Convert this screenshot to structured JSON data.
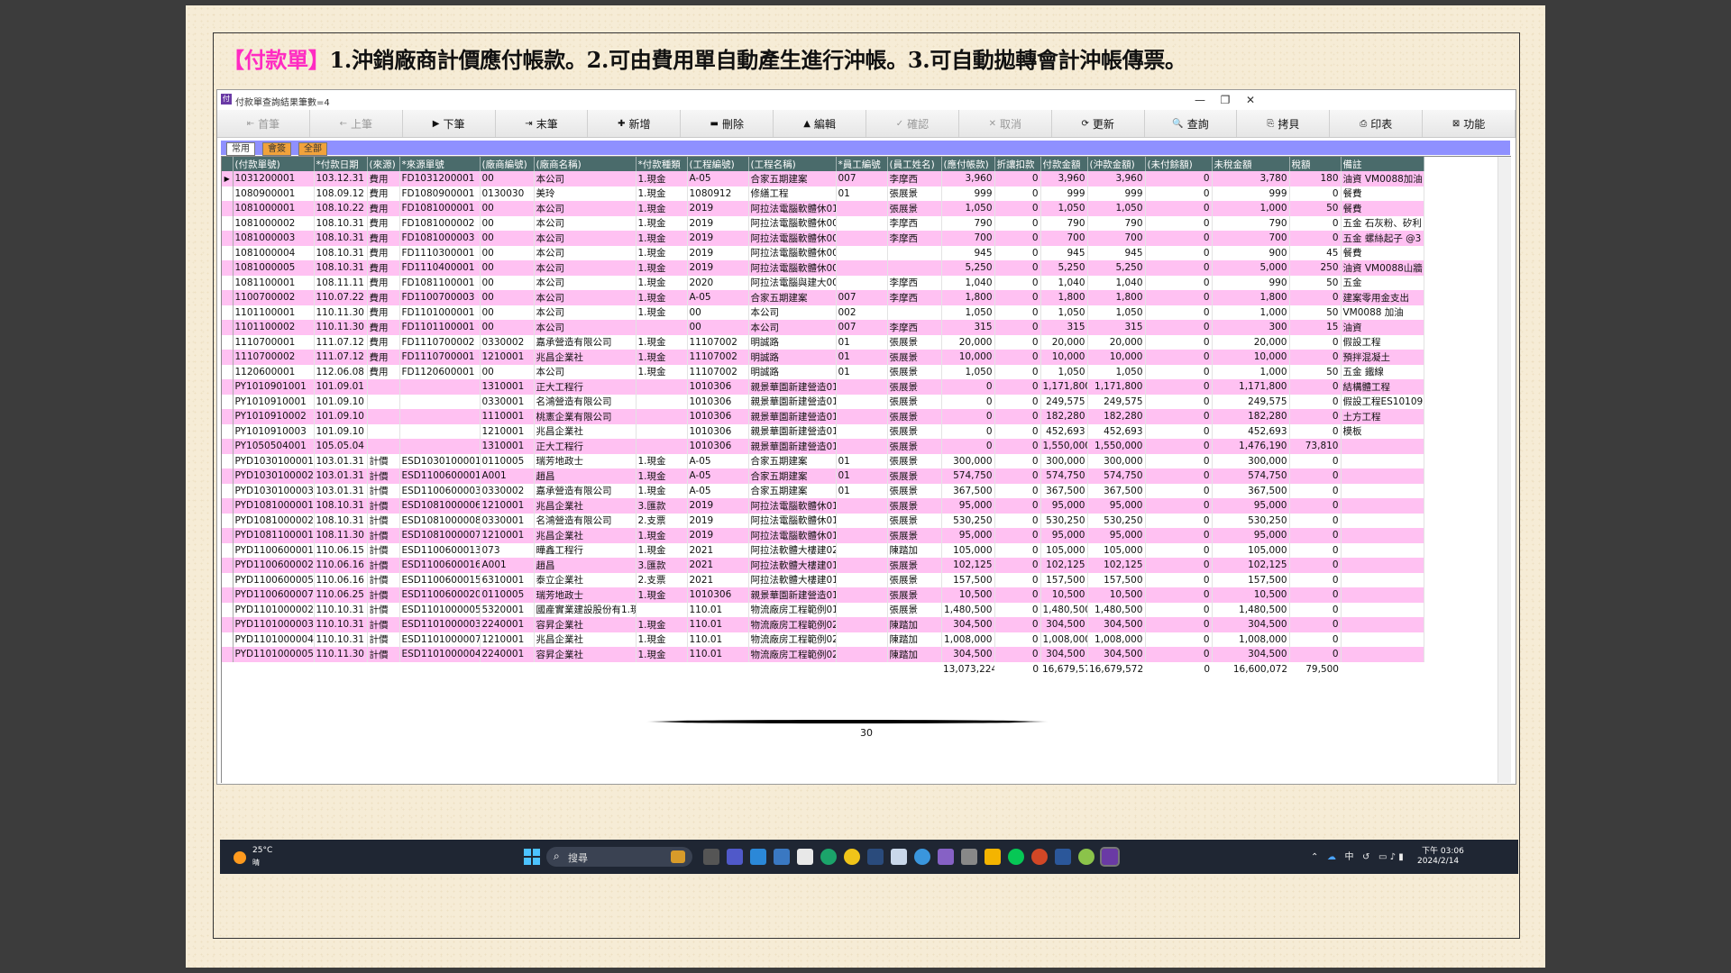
{
  "heading": {
    "tag": "【付款單】",
    "text": "1.沖銷廠商計價應付帳款。2.可由費用單自動產生進行沖帳。3.可自動拋轉會計沖帳傳票。"
  },
  "window": {
    "title": "付款單查詢結果筆數=4",
    "minimize": "—",
    "maximize": "❐",
    "close": "✕"
  },
  "toolbar": [
    {
      "icon": "⇤",
      "label": "首筆",
      "disabled": true
    },
    {
      "icon": "←",
      "label": "上筆",
      "disabled": true
    },
    {
      "icon": "▶",
      "label": "下筆",
      "disabled": false
    },
    {
      "icon": "⇥",
      "label": "末筆",
      "disabled": false
    },
    {
      "icon": "✚",
      "label": "新增",
      "disabled": false
    },
    {
      "icon": "▬",
      "label": "刪除",
      "disabled": false
    },
    {
      "icon": "▲",
      "label": "編輯",
      "disabled": false
    },
    {
      "icon": "✓",
      "label": "確認",
      "disabled": true
    },
    {
      "icon": "✕",
      "label": "取消",
      "disabled": true
    },
    {
      "icon": "⟳",
      "label": "更新",
      "disabled": false
    },
    {
      "icon": "🔍",
      "label": "查詢",
      "disabled": false
    },
    {
      "icon": "⎘",
      "label": "拷貝",
      "disabled": false
    },
    {
      "icon": "⎙",
      "label": "印表",
      "disabled": false
    },
    {
      "icon": "⊠",
      "label": "功能",
      "disabled": false
    }
  ],
  "tabs": [
    "常用",
    "會簽",
    "全部"
  ],
  "table": {
    "columns": [
      "(付款單號)",
      "*付款日期",
      "(來源)",
      "*來源單號",
      "(廠商編號)",
      "(廠商名稱)",
      "*付款種類",
      "(工程編號)",
      "(工程名稱)",
      "*員工編號",
      "(員工姓名)",
      "(應付帳款)",
      "折讓扣款",
      "付款金額",
      "(沖款金額)",
      "(未付餘額)",
      "未稅金額",
      "稅額",
      "備註"
    ],
    "rows": [
      [
        "1031200001",
        "103.12.31",
        "費用",
        "FD1031200001",
        "00",
        "本公司",
        "1.現金",
        "A-05",
        "合家五期建案",
        "007",
        "李摩西",
        "3,960",
        "0",
        "3,960",
        "3,960",
        "0",
        "3,780",
        "180",
        "油資 VM0088加油"
      ],
      [
        "1080900001",
        "108.09.12",
        "費用",
        "FD1080900001",
        "0130030",
        "美玲",
        "1.現金",
        "1080912",
        "修繕工程",
        "01",
        "張展景",
        "999",
        "0",
        "999",
        "999",
        "0",
        "999",
        "0",
        "餐費"
      ],
      [
        "1081000001",
        "108.10.22",
        "費用",
        "FD1081000001",
        "00",
        "本公司",
        "1.現金",
        "2019",
        "阿拉法電腦軟體休01",
        "",
        "張展景",
        "1,050",
        "0",
        "1,050",
        "1,050",
        "0",
        "1,000",
        "50",
        "餐費"
      ],
      [
        "1081000002",
        "108.10.31",
        "費用",
        "FD1081000002",
        "00",
        "本公司",
        "1.現金",
        "2019",
        "阿拉法電腦軟體休007",
        "",
        "李摩西",
        "790",
        "0",
        "790",
        "790",
        "0",
        "790",
        "0",
        "五金 石灰粉、矽利"
      ],
      [
        "1081000003",
        "108.10.31",
        "費用",
        "FD1081000003",
        "00",
        "本公司",
        "1.現金",
        "2019",
        "阿拉法電腦軟體休007",
        "",
        "李摩西",
        "700",
        "0",
        "700",
        "700",
        "0",
        "700",
        "0",
        "五金 螺絲起子 @3"
      ],
      [
        "1081000004",
        "108.10.31",
        "費用",
        "FD1110300001",
        "00",
        "本公司",
        "1.現金",
        "2019",
        "阿拉法電腦軟體休002",
        "",
        "",
        "945",
        "0",
        "945",
        "945",
        "0",
        "900",
        "45",
        "餐費"
      ],
      [
        "1081000005",
        "108.10.31",
        "費用",
        "FD1110400001",
        "00",
        "本公司",
        "1.現金",
        "2019",
        "阿拉法電腦軟體休002",
        "",
        "",
        "5,250",
        "0",
        "5,250",
        "5,250",
        "0",
        "5,000",
        "250",
        "油資 VM0088山牆"
      ],
      [
        "1081100001",
        "108.11.11",
        "費用",
        "FD1081100001",
        "00",
        "本公司",
        "1.現金",
        "2020",
        "阿拉法電腦與建大007",
        "",
        "李摩西",
        "1,040",
        "0",
        "1,040",
        "1,040",
        "0",
        "990",
        "50",
        "五金"
      ],
      [
        "1100700002",
        "110.07.22",
        "費用",
        "FD1100700003",
        "00",
        "本公司",
        "1.現金",
        "A-05",
        "合家五期建案",
        "007",
        "李摩西",
        "1,800",
        "0",
        "1,800",
        "1,800",
        "0",
        "1,800",
        "0",
        "建案零用金支出"
      ],
      [
        "1101100001",
        "110.11.30",
        "費用",
        "FD1101000001",
        "00",
        "本公司",
        "1.現金",
        "00",
        "本公司",
        "002",
        "",
        "1,050",
        "0",
        "1,050",
        "1,050",
        "0",
        "1,000",
        "50",
        "VM0088 加油"
      ],
      [
        "1101100002",
        "110.11.30",
        "費用",
        "FD1101100001",
        "00",
        "本公司",
        "",
        "00",
        "本公司",
        "007",
        "李摩西",
        "315",
        "0",
        "315",
        "315",
        "0",
        "300",
        "15",
        "油資"
      ],
      [
        "1110700001",
        "111.07.12",
        "費用",
        "FD1110700002",
        "0330002",
        "嘉承營造有限公司",
        "1.現金",
        "11107002",
        "明誠路",
        "01",
        "張展景",
        "20,000",
        "0",
        "20,000",
        "20,000",
        "0",
        "20,000",
        "0",
        "假設工程"
      ],
      [
        "1110700002",
        "111.07.12",
        "費用",
        "FD1110700001",
        "1210001",
        "兆昌企業社",
        "1.現金",
        "11107002",
        "明誠路",
        "01",
        "張展景",
        "10,000",
        "0",
        "10,000",
        "10,000",
        "0",
        "10,000",
        "0",
        "預拌混凝土"
      ],
      [
        "1120600001",
        "112.06.08",
        "費用",
        "FD1120600001",
        "00",
        "本公司",
        "1.現金",
        "11107002",
        "明誠路",
        "01",
        "張展景",
        "1,050",
        "0",
        "1,050",
        "1,050",
        "0",
        "1,000",
        "50",
        "五金 鐵線"
      ],
      [
        "PY1010901001",
        "101.09.01",
        "",
        "",
        "1310001",
        "正大工程行",
        "",
        "1010306",
        "親景華園新建營造01",
        "",
        "張展景",
        "0",
        "0",
        "1,171,800",
        "1,171,800",
        "0",
        "1,171,800",
        "0",
        "結構體工程"
      ],
      [
        "PY1010910001",
        "101.09.10",
        "",
        "",
        "0330001",
        "名鴻營造有限公司",
        "",
        "1010306",
        "親景華園新建營造01",
        "",
        "張展景",
        "0",
        "0",
        "249,575",
        "249,575",
        "0",
        "249,575",
        "0",
        "假設工程ES101091"
      ],
      [
        "PY1010910002",
        "101.09.10",
        "",
        "",
        "1110001",
        "桃憲企業有限公司",
        "",
        "1010306",
        "親景華園新建營造01",
        "",
        "張展景",
        "0",
        "0",
        "182,280",
        "182,280",
        "0",
        "182,280",
        "0",
        "土方工程"
      ],
      [
        "PY1010910003",
        "101.09.10",
        "",
        "",
        "1210001",
        "兆昌企業社",
        "",
        "1010306",
        "親景華園新建營造01",
        "",
        "張展景",
        "0",
        "0",
        "452,693",
        "452,693",
        "0",
        "452,693",
        "0",
        "模板"
      ],
      [
        "PY1050504001",
        "105.05.04",
        "",
        "",
        "1310001",
        "正大工程行",
        "",
        "1010306",
        "親景華園新建營造01",
        "",
        "張展景",
        "0",
        "0",
        "1,550,000",
        "1,550,000",
        "0",
        "1,476,190",
        "73,810",
        ""
      ],
      [
        "PYD1030100001",
        "103.01.31",
        "計價",
        "ESD1030100001",
        "0110005",
        "瑞芳地政士",
        "1.現金",
        "A-05",
        "合家五期建案",
        "01",
        "張展景",
        "300,000",
        "0",
        "300,000",
        "300,000",
        "0",
        "300,000",
        "0",
        ""
      ],
      [
        "PYD1030100002",
        "103.01.31",
        "計價",
        "ESD1100600001",
        "A001",
        "趙昌",
        "1.現金",
        "A-05",
        "合家五期建案",
        "01",
        "張展景",
        "574,750",
        "0",
        "574,750",
        "574,750",
        "0",
        "574,750",
        "0",
        ""
      ],
      [
        "PYD1030100003",
        "103.01.31",
        "計價",
        "ESD1100600003",
        "0330002",
        "嘉承營造有限公司",
        "1.現金",
        "A-05",
        "合家五期建案",
        "01",
        "張展景",
        "367,500",
        "0",
        "367,500",
        "367,500",
        "0",
        "367,500",
        "0",
        ""
      ],
      [
        "PYD1081000001",
        "108.10.31",
        "計價",
        "ESD1081000006",
        "1210001",
        "兆昌企業社",
        "3.匯款",
        "2019",
        "阿拉法電腦軟體休01",
        "",
        "張展景",
        "95,000",
        "0",
        "95,000",
        "95,000",
        "0",
        "95,000",
        "0",
        ""
      ],
      [
        "PYD1081000002",
        "108.10.31",
        "計價",
        "ESD1081000008",
        "0330001",
        "名鴻營造有限公司",
        "2.支票",
        "2019",
        "阿拉法電腦軟體休01",
        "",
        "張展景",
        "530,250",
        "0",
        "530,250",
        "530,250",
        "0",
        "530,250",
        "0",
        ""
      ],
      [
        "PYD1081100001",
        "108.11.30",
        "計價",
        "ESD1081000007",
        "1210001",
        "兆昌企業社",
        "1.現金",
        "2019",
        "阿拉法電腦軟體休01",
        "",
        "張展景",
        "95,000",
        "0",
        "95,000",
        "95,000",
        "0",
        "95,000",
        "0",
        ""
      ],
      [
        "PYD1100600001",
        "110.06.15",
        "計價",
        "ESD1100600013",
        "073",
        "曄鑫工程行",
        "1.現金",
        "2021",
        "阿拉法軟體大樓建02",
        "",
        "陳踏加",
        "105,000",
        "0",
        "105,000",
        "105,000",
        "0",
        "105,000",
        "0",
        ""
      ],
      [
        "PYD1100600002",
        "110.06.16",
        "計價",
        "ESD1100600016",
        "A001",
        "趙昌",
        "3.匯款",
        "2021",
        "阿拉法軟體大樓建01",
        "",
        "張展景",
        "102,125",
        "0",
        "102,125",
        "102,125",
        "0",
        "102,125",
        "0",
        ""
      ],
      [
        "PYD1100600005",
        "110.06.16",
        "計價",
        "ESD1100600015",
        "6310001",
        "泰立企業社",
        "2.支票",
        "2021",
        "阿拉法軟體大樓建01",
        "",
        "張展景",
        "157,500",
        "0",
        "157,500",
        "157,500",
        "0",
        "157,500",
        "0",
        ""
      ],
      [
        "PYD1100600007",
        "110.06.25",
        "計價",
        "ESD1100600020",
        "0110005",
        "瑞芳地政士",
        "1.現金",
        "1010306",
        "親景華園新建營造01",
        "",
        "張展景",
        "10,500",
        "0",
        "10,500",
        "10,500",
        "0",
        "10,500",
        "0",
        ""
      ],
      [
        "PYD1101000002",
        "110.10.31",
        "計價",
        "ESD1101000005",
        "5320001",
        "國產實業建設股份有1.現金",
        "",
        "110.01",
        "物流廠房工程範例01",
        "",
        "張展景",
        "1,480,500",
        "0",
        "1,480,500",
        "1,480,500",
        "0",
        "1,480,500",
        "0",
        ""
      ],
      [
        "PYD1101000003",
        "110.10.31",
        "計價",
        "ESD1101000003",
        "2240001",
        "容昇企業社",
        "1.現金",
        "110.01",
        "物流廠房工程範例02",
        "",
        "陳踏加",
        "304,500",
        "0",
        "304,500",
        "304,500",
        "0",
        "304,500",
        "0",
        ""
      ],
      [
        "PYD1101000004",
        "110.10.31",
        "計價",
        "ESD1101000007",
        "1210001",
        "兆昌企業社",
        "1.現金",
        "110.01",
        "物流廠房工程範例02",
        "",
        "陳踏加",
        "1,008,000",
        "0",
        "1,008,000",
        "1,008,000",
        "0",
        "1,008,000",
        "0",
        ""
      ],
      [
        "PYD1101000005",
        "110.11.30",
        "計價",
        "ESD1101000004",
        "2240001",
        "容昇企業社",
        "1.現金",
        "110.01",
        "物流廠房工程範例02",
        "",
        "陳踏加",
        "304,500",
        "0",
        "304,500",
        "304,500",
        "0",
        "304,500",
        "0",
        ""
      ]
    ],
    "totals": {
      "payable": "13,073,224",
      "discount": "0",
      "payment": "16,679,572",
      "offset": "16,679,572",
      "unpaid": "0",
      "pretax": "16,600,072",
      "tax": "79,500"
    }
  },
  "taskbar": {
    "temp": "25°C",
    "condition": "晴",
    "search_placeholder": "搜尋",
    "ime": "中",
    "time": "下午 03:06",
    "date": "2024/2/14"
  },
  "page_number": "30"
}
